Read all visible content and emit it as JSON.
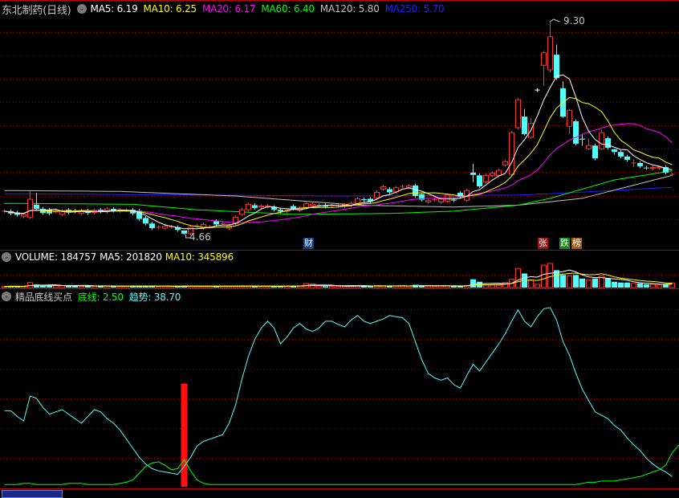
{
  "header": {
    "stock_title": "东北制药(日线)",
    "ma_labels": [
      {
        "text": "MA5: 6.19",
        "color": "#ffffff"
      },
      {
        "text": "MA10: 6.25",
        "color": "#ffff00"
      },
      {
        "text": "MA20: 6.17",
        "color": "#ff00ff"
      },
      {
        "text": "MA60: 6.40",
        "color": "#00ff00"
      },
      {
        "text": "MA120: 5.80",
        "color": "#c0c0c0"
      },
      {
        "text": "MA250: 5.70",
        "color": "#2020ff"
      }
    ]
  },
  "volume_header": {
    "volume": "VOLUME: 184757",
    "ma5": "MA5: 201820",
    "ma10": "MA10: 345896"
  },
  "indicator_header": {
    "name": "精品底线买点",
    "base": "底线: 2.50",
    "trend": "趋势: 38.70"
  },
  "annotations": {
    "high": "9.30",
    "low": "4.66"
  },
  "tags": [
    {
      "text": "财",
      "bg": "#1c3d78"
    },
    {
      "text": "张",
      "bg": "#a01010"
    },
    {
      "text": "跌",
      "bg": "#108a10"
    },
    {
      "text": "榜",
      "bg": "#a05a10"
    }
  ],
  "colors": {
    "up": "#ff3232",
    "down": "#54fcfc",
    "ma5": "#ffffff",
    "ma10": "#ffff00",
    "ma20": "#ff00ff",
    "ma60": "#00ff00",
    "ma120": "#c0c0c0",
    "ma250": "#2020ff",
    "grid": "#8a0000",
    "frame": "#c00000"
  },
  "chart_data": {
    "type": "candlestick",
    "price_range": [
      4.66,
      9.3
    ],
    "candles_open_close": [
      [
        5.17,
        5.17
      ],
      [
        5.17,
        5.12
      ],
      [
        5.14,
        5.09
      ],
      [
        5.06,
        5.1
      ],
      [
        5.04,
        5.43
      ],
      [
        5.31,
        5.22
      ],
      [
        5.22,
        5.13
      ],
      [
        5.2,
        5.12
      ],
      [
        5.16,
        5.17
      ],
      [
        5.1,
        5.18
      ],
      [
        5.2,
        5.14
      ],
      [
        5.18,
        5.16
      ],
      [
        5.12,
        5.18
      ],
      [
        5.18,
        5.13
      ],
      [
        5.14,
        5.19
      ],
      [
        5.2,
        5.16
      ],
      [
        5.16,
        5.22
      ],
      [
        5.22,
        5.18
      ],
      [
        5.17,
        5.2
      ],
      [
        5.19,
        5.19
      ],
      [
        5.2,
        5.12
      ],
      [
        5.18,
        5.0
      ],
      [
        5.02,
        4.9
      ],
      [
        4.9,
        4.8
      ],
      [
        4.82,
        4.82
      ],
      [
        4.8,
        4.84
      ],
      [
        4.83,
        4.83
      ],
      [
        4.82,
        4.76
      ],
      [
        4.75,
        4.68
      ],
      [
        4.68,
        4.82
      ],
      [
        4.85,
        4.85
      ],
      [
        4.8,
        4.88
      ],
      [
        4.83,
        4.83
      ],
      [
        4.95,
        4.88
      ],
      [
        4.9,
        4.9
      ],
      [
        4.8,
        4.85
      ],
      [
        4.9,
        5.04
      ],
      [
        5.1,
        5.2
      ],
      [
        5.2,
        5.32
      ],
      [
        5.3,
        5.24
      ],
      [
        5.26,
        5.28
      ],
      [
        5.27,
        5.28
      ],
      [
        5.26,
        5.2
      ],
      [
        5.2,
        5.16
      ],
      [
        5.17,
        5.19
      ],
      [
        5.28,
        5.22
      ],
      [
        5.19,
        5.24
      ],
      [
        5.25,
        5.33
      ],
      [
        5.28,
        5.32
      ],
      [
        5.3,
        5.3
      ],
      [
        5.3,
        5.27
      ],
      [
        5.29,
        5.29
      ],
      [
        5.29,
        5.29
      ],
      [
        5.28,
        5.31
      ],
      [
        5.3,
        5.34
      ],
      [
        5.34,
        5.44
      ],
      [
        5.43,
        5.41
      ],
      [
        5.44,
        5.38
      ],
      [
        5.46,
        5.58
      ],
      [
        5.65,
        5.7
      ],
      [
        5.65,
        5.58
      ],
      [
        5.59,
        5.68
      ],
      [
        5.71,
        5.71
      ],
      [
        5.69,
        5.72
      ],
      [
        5.73,
        5.5
      ],
      [
        5.54,
        5.42
      ],
      [
        5.37,
        5.4
      ],
      [
        5.42,
        5.42
      ],
      [
        5.37,
        5.44
      ],
      [
        5.39,
        5.52
      ],
      [
        5.42,
        5.41
      ],
      [
        5.57,
        5.48
      ],
      [
        5.41,
        5.62
      ],
      [
        6.01,
        5.96
      ],
      [
        5.95,
        5.71
      ],
      [
        5.81,
        5.95
      ],
      [
        5.95,
        6.0
      ],
      [
        5.95,
        6.06
      ],
      [
        6.18,
        6.25
      ],
      [
        5.97,
        6.88
      ],
      [
        6.99,
        7.6
      ],
      [
        7.23,
        6.85
      ],
      [
        6.78,
        7.08
      ],
      [
        7.81,
        7.81
      ],
      [
        8.35,
        8.62
      ],
      [
        8.25,
        8.97
      ],
      [
        8.58,
        8.07
      ],
      [
        7.85,
        7.23
      ],
      [
        7.02,
        7.37
      ],
      [
        7.13,
        6.64
      ],
      [
        6.75,
        6.73
      ],
      [
        6.53,
        6.6
      ],
      [
        6.6,
        6.32
      ],
      [
        6.53,
        6.88
      ],
      [
        6.76,
        6.55
      ],
      [
        6.52,
        6.46
      ],
      [
        6.46,
        6.36
      ],
      [
        6.36,
        6.29
      ],
      [
        6.22,
        6.22
      ],
      [
        6.22,
        6.15
      ],
      [
        6.12,
        6.11
      ],
      [
        6.1,
        6.12
      ],
      [
        6.11,
        6.13
      ],
      [
        6.13,
        6.01
      ],
      [
        5.97,
        5.97
      ]
    ],
    "extremes": {
      "4": [
        5.6,
        5.0
      ],
      "5": [
        5.57,
        5.2
      ],
      "28": [
        4.75,
        4.66
      ],
      "73": [
        6.2,
        5.8
      ],
      "81": [
        7.4,
        6.82
      ],
      "82": [
        7.2,
        6.75
      ],
      "84": [
        8.66,
        7.9
      ],
      "85": [
        9.3,
        8.2
      ],
      "86": [
        8.8,
        8.03
      ],
      "87": [
        8.0,
        7.2
      ],
      "88": [
        7.4,
        6.85
      ],
      "90": [
        6.86,
        6.6
      ],
      "91": [
        6.75,
        6.5
      ],
      "93": [
        6.95,
        6.5
      ],
      "95": [
        6.53,
        6.4
      ],
      "98": [
        6.3,
        6.13
      ]
    },
    "long_ma_keypoints": {
      "ma60": [
        [
          0,
          5.34
        ],
        [
          20,
          5.32
        ],
        [
          30,
          5.2
        ],
        [
          45,
          5.1
        ],
        [
          60,
          5.12
        ],
        [
          70,
          5.17
        ],
        [
          80,
          5.3
        ],
        [
          85,
          5.45
        ],
        [
          90,
          5.65
        ],
        [
          95,
          5.85
        ],
        [
          104,
          6.05
        ]
      ],
      "ma120": [
        [
          0,
          5.62
        ],
        [
          18,
          5.6
        ],
        [
          36,
          5.5
        ],
        [
          55,
          5.3
        ],
        [
          70,
          5.26
        ],
        [
          80,
          5.3
        ],
        [
          90,
          5.45
        ],
        [
          104,
          5.95
        ]
      ],
      "ma250": [
        [
          0,
          5.55
        ],
        [
          52,
          5.5
        ],
        [
          80,
          5.52
        ],
        [
          88,
          5.57
        ],
        [
          104,
          5.69
        ]
      ]
    },
    "volume_range": [
      0,
      1000000
    ],
    "volume_thousands": [
      40,
      60,
      50,
      45,
      200,
      120,
      70,
      80,
      75,
      70,
      60,
      65,
      60,
      70,
      60,
      55,
      60,
      65,
      55,
      60,
      60,
      70,
      65,
      60,
      50,
      55,
      50,
      60,
      65,
      60,
      55,
      50,
      55,
      60,
      50,
      55,
      60,
      70,
      65,
      60,
      55,
      50,
      60,
      65,
      55,
      60,
      70,
      160,
      150,
      60,
      55,
      50,
      55,
      60,
      65,
      70,
      60,
      55,
      80,
      70,
      65,
      60,
      70,
      55,
      110,
      90,
      60,
      55,
      60,
      70,
      60,
      55,
      80,
      330,
      230,
      100,
      100,
      100,
      200,
      330,
      760,
      560,
      300,
      130,
      890,
      960,
      690,
      500,
      460,
      500,
      360,
      300,
      360,
      460,
      360,
      230,
      200,
      200,
      165,
      165,
      130,
      130,
      100,
      130,
      185
    ],
    "indicator_range": [
      0,
      170
    ],
    "trend": [
      67,
      67,
      62,
      58,
      80,
      78,
      70,
      64,
      66,
      68,
      64,
      60,
      56,
      62,
      68,
      66,
      60,
      56,
      50,
      42,
      34,
      26,
      20,
      16,
      14,
      13,
      12,
      11,
      18,
      26,
      36,
      40,
      42,
      44,
      46,
      56,
      72,
      95,
      115,
      130,
      140,
      146,
      140,
      126,
      132,
      140,
      144,
      139,
      137,
      140,
      146,
      146,
      143,
      141,
      147,
      151,
      146,
      144,
      146,
      148,
      151,
      150,
      149,
      144,
      128,
      112,
      100,
      96,
      94,
      96,
      90,
      87,
      98,
      108,
      102,
      110,
      118,
      126,
      135,
      146,
      156,
      146,
      141,
      150,
      157,
      158,
      147,
      128,
      116,
      100,
      86,
      76,
      66,
      63,
      60,
      54,
      50,
      43,
      37,
      32,
      25,
      20,
      16,
      13,
      9
    ],
    "base": [
      2,
      2,
      2,
      3,
      3,
      2,
      2,
      2,
      2,
      2,
      3,
      3,
      3,
      2,
      2,
      2,
      2,
      2,
      3,
      4,
      6,
      12,
      18,
      21,
      22,
      19,
      15,
      16,
      24,
      14,
      6,
      3,
      2,
      2,
      2,
      2,
      2,
      2,
      2,
      2,
      2,
      2,
      2,
      2,
      2,
      2,
      2,
      2,
      2,
      2,
      2,
      2,
      2,
      2,
      2,
      2,
      2,
      2,
      2,
      2,
      2,
      2,
      2,
      2,
      2,
      2,
      2,
      2,
      2,
      2,
      2,
      2,
      2,
      2,
      2,
      2,
      2,
      2,
      2,
      2,
      2,
      2,
      2,
      2,
      2,
      2,
      2,
      2,
      2,
      2,
      3,
      4,
      4,
      5,
      5,
      5,
      6,
      7,
      8,
      9,
      11,
      13,
      15,
      19,
      30
    ],
    "buy_signal": {
      "index": 28,
      "value": 91
    }
  }
}
